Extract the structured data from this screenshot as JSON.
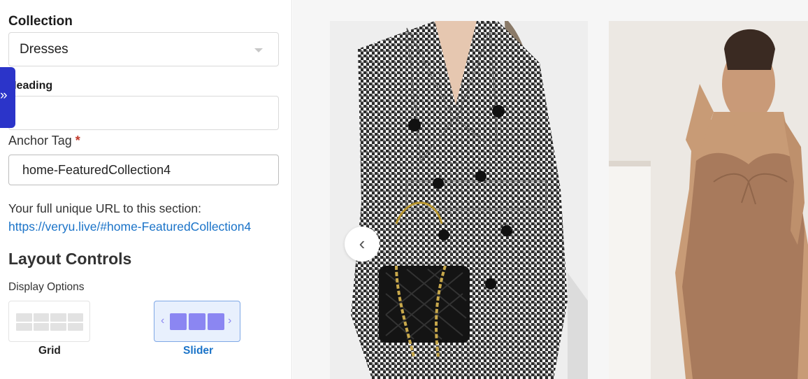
{
  "panel": {
    "collection_label": "Collection",
    "collection_value": "Dresses",
    "heading_label": "Heading",
    "heading_value": "",
    "anchor_label": "Anchor Tag",
    "anchor_required": "*",
    "anchor_value": "home-FeaturedCollection4",
    "url_caption": "Your full unique URL to this section:",
    "url_link": "https://veryu.live/#home-FeaturedCollection4",
    "layout_title": "Layout Controls",
    "display_options_label": "Display Options",
    "options": [
      {
        "name": "Grid",
        "selected": false,
        "icon": "grid-layout-icon"
      },
      {
        "name": "Slider",
        "selected": true,
        "icon": "slider-layout-icon"
      }
    ],
    "collapse_icon": "double-chevron-right-icon"
  },
  "preview": {
    "prev_icon": "chevron-left-icon",
    "products": [
      {
        "image": "houndstooth-blazer-dress-photo"
      },
      {
        "image": "tan-cami-dress-photo"
      }
    ]
  },
  "colors": {
    "accent": "#2b34c9",
    "link": "#1a73c8",
    "slider_accent": "#8b86f2",
    "required": "#c0392b"
  }
}
